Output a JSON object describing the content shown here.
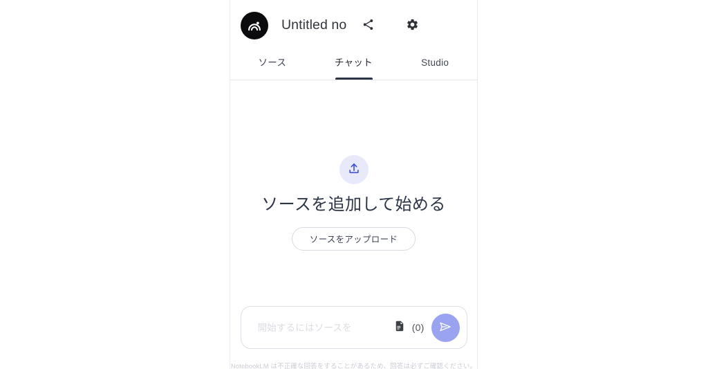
{
  "app": {
    "logo_icon": "notebooklm-logo-icon",
    "title": "Untitled no"
  },
  "header": {
    "share_icon": "share-icon",
    "settings_icon": "gear-icon"
  },
  "tabs": [
    {
      "id": "sources",
      "label": "ソース",
      "active": false
    },
    {
      "id": "chat",
      "label": "チャット",
      "active": true
    },
    {
      "id": "studio",
      "label": "Studio",
      "active": false
    }
  ],
  "empty_state": {
    "upload_icon": "upload-icon",
    "heading": "ソースを追加して始める",
    "upload_button_label": "ソースをアップロード"
  },
  "composer": {
    "placeholder": "開始するにはソースを",
    "value": "",
    "document_icon": "document-icon",
    "source_count": "(0)",
    "send_icon": "send-icon"
  },
  "footer": {
    "disclaimer": "NotebookLM は不正確な回答をすることがあるため、回答は必ずご確認ください。"
  },
  "colors": {
    "accent_send": "#9aa3f0",
    "accent_upload_bg": "#e8eafb",
    "accent_upload_icon": "#3f51d8",
    "tab_active_underline": "#2b3445",
    "heading_text": "#2d3646",
    "panel_border": "#e6e7ec"
  }
}
